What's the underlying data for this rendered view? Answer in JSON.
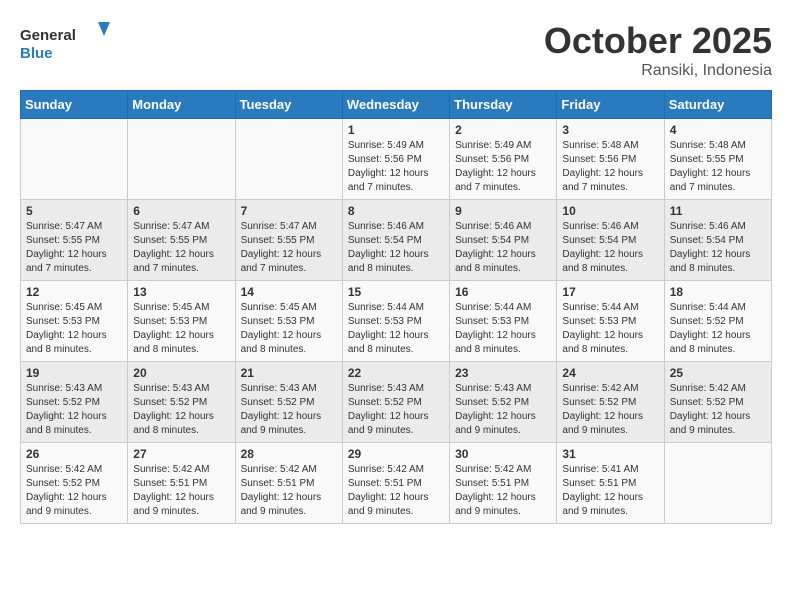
{
  "header": {
    "logo_general": "General",
    "logo_blue": "Blue",
    "month": "October 2025",
    "location": "Ransiki, Indonesia"
  },
  "weekdays": [
    "Sunday",
    "Monday",
    "Tuesday",
    "Wednesday",
    "Thursday",
    "Friday",
    "Saturday"
  ],
  "weeks": [
    [
      {
        "day": "",
        "sunrise": "",
        "sunset": "",
        "daylight": ""
      },
      {
        "day": "",
        "sunrise": "",
        "sunset": "",
        "daylight": ""
      },
      {
        "day": "",
        "sunrise": "",
        "sunset": "",
        "daylight": ""
      },
      {
        "day": "1",
        "sunrise": "Sunrise: 5:49 AM",
        "sunset": "Sunset: 5:56 PM",
        "daylight": "Daylight: 12 hours and 7 minutes."
      },
      {
        "day": "2",
        "sunrise": "Sunrise: 5:49 AM",
        "sunset": "Sunset: 5:56 PM",
        "daylight": "Daylight: 12 hours and 7 minutes."
      },
      {
        "day": "3",
        "sunrise": "Sunrise: 5:48 AM",
        "sunset": "Sunset: 5:56 PM",
        "daylight": "Daylight: 12 hours and 7 minutes."
      },
      {
        "day": "4",
        "sunrise": "Sunrise: 5:48 AM",
        "sunset": "Sunset: 5:55 PM",
        "daylight": "Daylight: 12 hours and 7 minutes."
      }
    ],
    [
      {
        "day": "5",
        "sunrise": "Sunrise: 5:47 AM",
        "sunset": "Sunset: 5:55 PM",
        "daylight": "Daylight: 12 hours and 7 minutes."
      },
      {
        "day": "6",
        "sunrise": "Sunrise: 5:47 AM",
        "sunset": "Sunset: 5:55 PM",
        "daylight": "Daylight: 12 hours and 7 minutes."
      },
      {
        "day": "7",
        "sunrise": "Sunrise: 5:47 AM",
        "sunset": "Sunset: 5:55 PM",
        "daylight": "Daylight: 12 hours and 7 minutes."
      },
      {
        "day": "8",
        "sunrise": "Sunrise: 5:46 AM",
        "sunset": "Sunset: 5:54 PM",
        "daylight": "Daylight: 12 hours and 8 minutes."
      },
      {
        "day": "9",
        "sunrise": "Sunrise: 5:46 AM",
        "sunset": "Sunset: 5:54 PM",
        "daylight": "Daylight: 12 hours and 8 minutes."
      },
      {
        "day": "10",
        "sunrise": "Sunrise: 5:46 AM",
        "sunset": "Sunset: 5:54 PM",
        "daylight": "Daylight: 12 hours and 8 minutes."
      },
      {
        "day": "11",
        "sunrise": "Sunrise: 5:46 AM",
        "sunset": "Sunset: 5:54 PM",
        "daylight": "Daylight: 12 hours and 8 minutes."
      }
    ],
    [
      {
        "day": "12",
        "sunrise": "Sunrise: 5:45 AM",
        "sunset": "Sunset: 5:53 PM",
        "daylight": "Daylight: 12 hours and 8 minutes."
      },
      {
        "day": "13",
        "sunrise": "Sunrise: 5:45 AM",
        "sunset": "Sunset: 5:53 PM",
        "daylight": "Daylight: 12 hours and 8 minutes."
      },
      {
        "day": "14",
        "sunrise": "Sunrise: 5:45 AM",
        "sunset": "Sunset: 5:53 PM",
        "daylight": "Daylight: 12 hours and 8 minutes."
      },
      {
        "day": "15",
        "sunrise": "Sunrise: 5:44 AM",
        "sunset": "Sunset: 5:53 PM",
        "daylight": "Daylight: 12 hours and 8 minutes."
      },
      {
        "day": "16",
        "sunrise": "Sunrise: 5:44 AM",
        "sunset": "Sunset: 5:53 PM",
        "daylight": "Daylight: 12 hours and 8 minutes."
      },
      {
        "day": "17",
        "sunrise": "Sunrise: 5:44 AM",
        "sunset": "Sunset: 5:53 PM",
        "daylight": "Daylight: 12 hours and 8 minutes."
      },
      {
        "day": "18",
        "sunrise": "Sunrise: 5:44 AM",
        "sunset": "Sunset: 5:52 PM",
        "daylight": "Daylight: 12 hours and 8 minutes."
      }
    ],
    [
      {
        "day": "19",
        "sunrise": "Sunrise: 5:43 AM",
        "sunset": "Sunset: 5:52 PM",
        "daylight": "Daylight: 12 hours and 8 minutes."
      },
      {
        "day": "20",
        "sunrise": "Sunrise: 5:43 AM",
        "sunset": "Sunset: 5:52 PM",
        "daylight": "Daylight: 12 hours and 8 minutes."
      },
      {
        "day": "21",
        "sunrise": "Sunrise: 5:43 AM",
        "sunset": "Sunset: 5:52 PM",
        "daylight": "Daylight: 12 hours and 9 minutes."
      },
      {
        "day": "22",
        "sunrise": "Sunrise: 5:43 AM",
        "sunset": "Sunset: 5:52 PM",
        "daylight": "Daylight: 12 hours and 9 minutes."
      },
      {
        "day": "23",
        "sunrise": "Sunrise: 5:43 AM",
        "sunset": "Sunset: 5:52 PM",
        "daylight": "Daylight: 12 hours and 9 minutes."
      },
      {
        "day": "24",
        "sunrise": "Sunrise: 5:42 AM",
        "sunset": "Sunset: 5:52 PM",
        "daylight": "Daylight: 12 hours and 9 minutes."
      },
      {
        "day": "25",
        "sunrise": "Sunrise: 5:42 AM",
        "sunset": "Sunset: 5:52 PM",
        "daylight": "Daylight: 12 hours and 9 minutes."
      }
    ],
    [
      {
        "day": "26",
        "sunrise": "Sunrise: 5:42 AM",
        "sunset": "Sunset: 5:52 PM",
        "daylight": "Daylight: 12 hours and 9 minutes."
      },
      {
        "day": "27",
        "sunrise": "Sunrise: 5:42 AM",
        "sunset": "Sunset: 5:51 PM",
        "daylight": "Daylight: 12 hours and 9 minutes."
      },
      {
        "day": "28",
        "sunrise": "Sunrise: 5:42 AM",
        "sunset": "Sunset: 5:51 PM",
        "daylight": "Daylight: 12 hours and 9 minutes."
      },
      {
        "day": "29",
        "sunrise": "Sunrise: 5:42 AM",
        "sunset": "Sunset: 5:51 PM",
        "daylight": "Daylight: 12 hours and 9 minutes."
      },
      {
        "day": "30",
        "sunrise": "Sunrise: 5:42 AM",
        "sunset": "Sunset: 5:51 PM",
        "daylight": "Daylight: 12 hours and 9 minutes."
      },
      {
        "day": "31",
        "sunrise": "Sunrise: 5:41 AM",
        "sunset": "Sunset: 5:51 PM",
        "daylight": "Daylight: 12 hours and 9 minutes."
      },
      {
        "day": "",
        "sunrise": "",
        "sunset": "",
        "daylight": ""
      }
    ]
  ]
}
